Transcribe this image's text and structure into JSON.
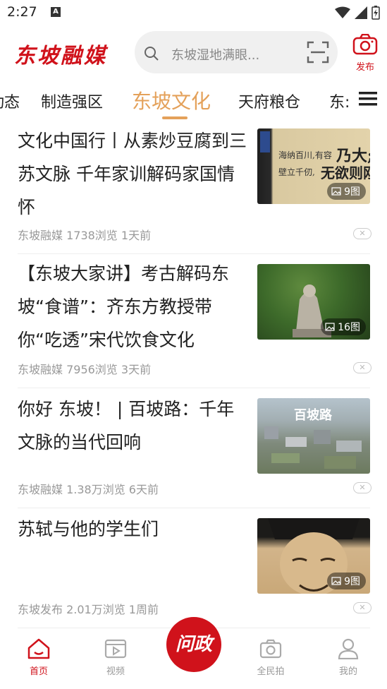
{
  "status_bar": {
    "time": "2:27",
    "notification_icon": "A"
  },
  "header": {
    "logo_text": "东坡融媒",
    "search_placeholder": "东坡湿地满眼...",
    "publish_label": "发布"
  },
  "tabs": [
    {
      "label": "动态"
    },
    {
      "label": "制造强区"
    },
    {
      "label": "东坡文化",
      "active": true
    },
    {
      "label": "天府粮仓"
    },
    {
      "label": "东:"
    }
  ],
  "feed": [
    {
      "title": "文化中国行丨从素炒豆腐到三苏文脉 千年家训解码家国情怀",
      "meta": "东坡融媒 1738浏览 1天前",
      "image_count": "9图"
    },
    {
      "title": "【东坡大家讲】考古解码东坡“食谱”：齐东方教授带你“吃透”宋代饮食文化",
      "meta": "东坡融媒 7956浏览 3天前",
      "image_count": "16图"
    },
    {
      "title": "你好 东坡！ | 百坡路：千年文脉的当代回响",
      "meta": "东坡融媒 1.38万浏览 6天前",
      "image_count": ""
    },
    {
      "title": "苏轼与他的学生们",
      "meta": "东坡发布 2.01万浏览 1周前",
      "image_count": "9图"
    }
  ],
  "bottom_nav": {
    "home": "首页",
    "video": "视频",
    "center": "问政",
    "citizen": "全民拍",
    "mine": "我的"
  },
  "colors": {
    "brand_red": "#d0121b",
    "tab_accent": "#e4a15a"
  }
}
